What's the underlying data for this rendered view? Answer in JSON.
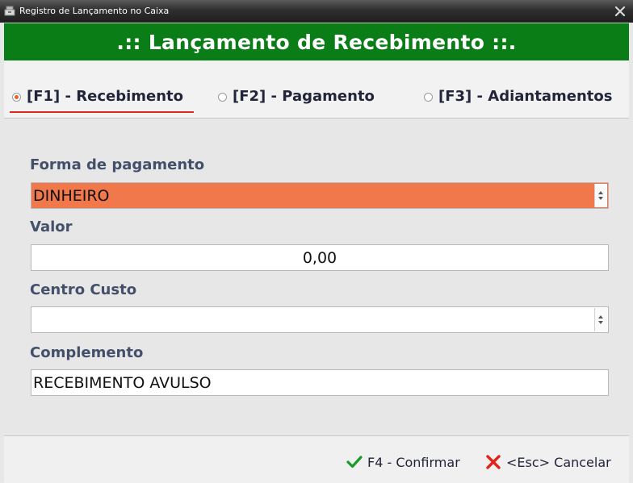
{
  "window": {
    "title": "Registro de Lançamento no Caixa"
  },
  "header": {
    "title": ".:: Lançamento de Recebimento ::."
  },
  "tabs": [
    {
      "label": "[F1] - Recebimento",
      "selected": true
    },
    {
      "label": "[F2] - Pagamento",
      "selected": false
    },
    {
      "label": "[F3] - Adiantamentos",
      "selected": false
    }
  ],
  "form": {
    "forma_pagamento": {
      "label": "Forma de pagamento",
      "value": "DINHEIRO"
    },
    "valor": {
      "label": "Valor",
      "value": "0,00"
    },
    "centro_custo": {
      "label": "Centro Custo",
      "value": ""
    },
    "complemento": {
      "label": "Complemento",
      "value": "RECEBIMENTO AVULSO"
    }
  },
  "footer": {
    "confirm_label": "F4 - Confirmar",
    "cancel_label": "<Esc> Cancelar"
  },
  "colors": {
    "banner": "#0b7d17",
    "selected_field": "#f0784a",
    "accent": "#e0281e"
  },
  "icons": {
    "app": "cash-register-icon",
    "close": "close-icon",
    "confirm": "check-icon",
    "cancel": "x-icon"
  }
}
